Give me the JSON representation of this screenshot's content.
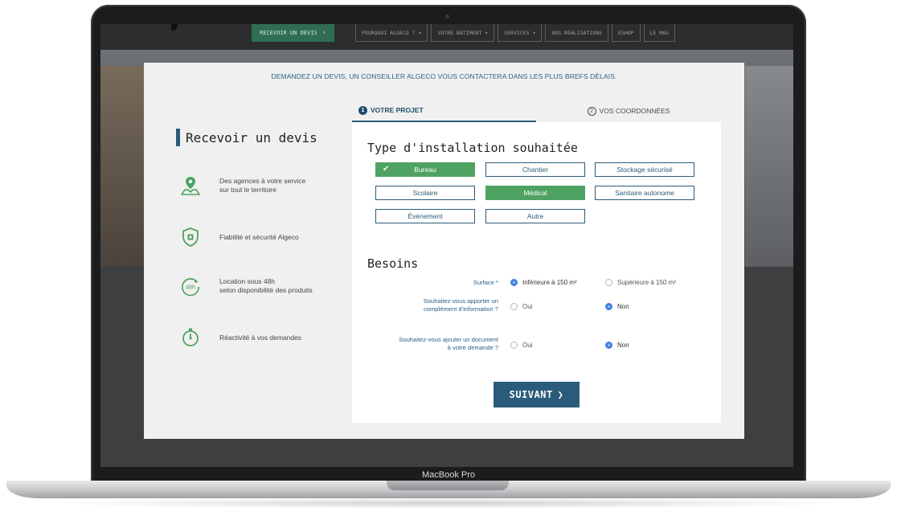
{
  "device": {
    "label": "MacBook Pro"
  },
  "colors": {
    "accent": "#2b5b7a",
    "selected": "#4ea262",
    "radio_on": "#3f7fe0",
    "link_text": "#2a6185"
  },
  "nav": {
    "cta": "RECEVOIR UN DEVIS",
    "items": [
      "POURQUOI ALGECO ?",
      "VOTRE BÂTIMENT",
      "SERVICES",
      "NOS RÉALISATIONS",
      "ESHOP",
      "LE MAG"
    ]
  },
  "modal": {
    "intro": "DEMANDEZ UN DEVIS, UN CONSEILLER ALGECO VOUS CONTACTERA DANS LES PLUS BREFS DÉLAIS.",
    "steps": [
      {
        "num": "1",
        "label": "VOTRE PROJET"
      },
      {
        "num": "2",
        "label": "VOS COORDONNÉES"
      }
    ],
    "left_title": "Recevoir un devis",
    "features": [
      {
        "icon": "map-pin-people-icon",
        "text": [
          "Des agences à votre service",
          "sur tout le territoire"
        ]
      },
      {
        "icon": "shield-icon",
        "text": [
          "Fiabilité et sécurité Algeco"
        ]
      },
      {
        "icon": "clock-48h-icon",
        "icon_text": "48h",
        "text": [
          "Location sous 48h",
          "selon disponibilité des produits"
        ]
      },
      {
        "icon": "stopwatch-icon",
        "text": [
          "Réactivité à vos demandes"
        ]
      }
    ],
    "installation": {
      "title": "Type d'installation souhaitée",
      "options": [
        {
          "label": "Bureau",
          "selected": true
        },
        {
          "label": "Chantier",
          "selected": false
        },
        {
          "label": "Stockage sécurisé",
          "selected": false
        },
        {
          "label": "Scolaire",
          "selected": false
        },
        {
          "label": "Médical",
          "selected": true
        },
        {
          "label": "Sanitaire autonome",
          "selected": false
        },
        {
          "label": "Évènement",
          "selected": false
        },
        {
          "label": "Autre",
          "selected": false
        }
      ]
    },
    "besoins": {
      "title": "Besoins",
      "questions": [
        {
          "label": [
            "Surface *"
          ],
          "options": [
            {
              "label": "Inférieure à 150 m²",
              "checked": true
            },
            {
              "label": "Supérieure à 150 m²",
              "checked": false
            }
          ]
        },
        {
          "label": [
            "Souhaitez-vous apporter un",
            "complément d'information ?"
          ],
          "options": [
            {
              "label": "Oui",
              "checked": false
            },
            {
              "label": "Non",
              "checked": true
            }
          ]
        },
        {
          "label": [
            "Souhaitez-vous ajouter un document",
            "à votre demande ?"
          ],
          "options": [
            {
              "label": "Oui",
              "checked": false
            },
            {
              "label": "Non",
              "checked": true
            }
          ]
        }
      ]
    },
    "next_button": "SUIVANT",
    "next_icon": "chevron-right-icon"
  }
}
